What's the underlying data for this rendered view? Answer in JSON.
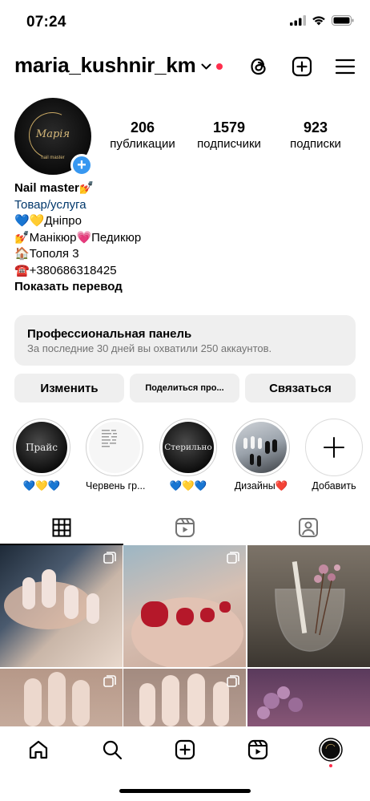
{
  "status_bar": {
    "time": "07:24",
    "icons": [
      "signal-icon",
      "wifi-icon",
      "battery-icon"
    ]
  },
  "header": {
    "username": "maria_kushnir_km",
    "icons": [
      "chevron-down-icon",
      "threads-icon",
      "create-icon",
      "menu-icon"
    ],
    "notification_dot_color": "#ff2e4c"
  },
  "profile": {
    "avatar_text": "Марія",
    "avatar_subtext": "nail master",
    "stats": [
      {
        "value": "206",
        "label": "публикации"
      },
      {
        "value": "1579",
        "label": "подписчики"
      },
      {
        "value": "923",
        "label": "подписки"
      }
    ],
    "bio": {
      "name": "Nail master💅",
      "category": "Товар/услуга",
      "lines": [
        "💙💛Дніпро",
        "💅Манікюр💗Педикюр",
        "🏠Тополя 3",
        "☎️+380686318425"
      ],
      "translate": "Показать перевод"
    }
  },
  "pro_panel": {
    "title": "Профессиональная панель",
    "subtitle": "За последние 30 дней вы охватили 250 аккаунтов."
  },
  "buttons": {
    "edit": "Изменить",
    "share": "Поделиться про...",
    "contact": "Связаться"
  },
  "highlights": [
    {
      "label": "💙💛💙",
      "cover_text": "Прайс"
    },
    {
      "label": "Червень гр..."
    },
    {
      "label": "💙💛💙",
      "cover_text": "Стерильно"
    },
    {
      "label": "Дизайны❤️"
    },
    {
      "label": "Добавить"
    }
  ],
  "tabs": [
    "grid-icon",
    "reels-icon",
    "tagged-icon"
  ],
  "nav": [
    "home-icon",
    "search-icon",
    "create-icon",
    "reels-icon",
    "profile-avatar"
  ],
  "colors": {
    "accent": "#3797f0",
    "link": "#00376b",
    "panel_bg": "#efefef",
    "secondary_text": "#737373"
  }
}
